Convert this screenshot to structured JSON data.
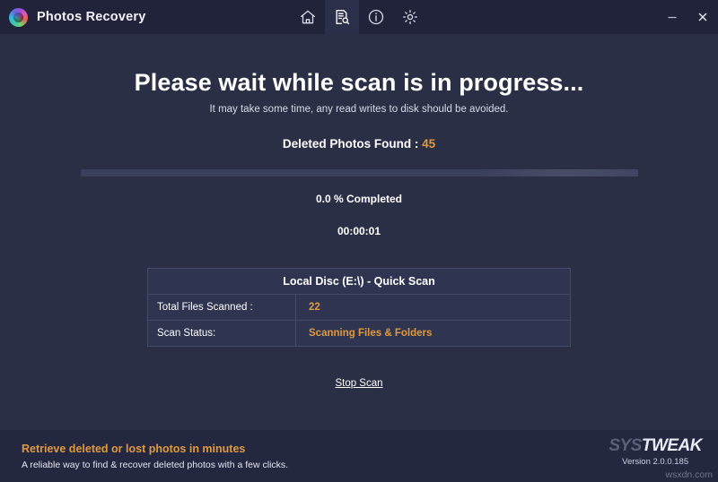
{
  "window": {
    "title": "Photos Recovery",
    "logo_icon": "photos-recovery-logo-icon",
    "minimize_label": "Minimize",
    "close_label": "Close"
  },
  "toolbar": {
    "items": [
      {
        "name": "home",
        "icon": "home-icon",
        "active": false
      },
      {
        "name": "scan",
        "icon": "document-search-icon",
        "active": true
      },
      {
        "name": "info",
        "icon": "info-circle-icon",
        "active": false
      },
      {
        "name": "settings",
        "icon": "gear-icon",
        "active": false
      }
    ]
  },
  "main": {
    "headline": "Please wait while scan is in progress...",
    "subline": "It may take some time, any read writes to disk should be avoided.",
    "found_label": "Deleted Photos Found : ",
    "found_count": "45",
    "progress_percent": 0.0,
    "percent_text": "0.0 % Completed",
    "elapsed_time": "00:00:01",
    "stop_scan_label": "Stop Scan"
  },
  "scan_table": {
    "header": "Local Disc (E:\\) - Quick Scan",
    "rows": [
      {
        "label": "Total Files Scanned :",
        "value": "22"
      },
      {
        "label": "Scan Status:",
        "value": "Scanning Files & Folders"
      }
    ]
  },
  "footer": {
    "tagline": "Retrieve deleted or lost photos in minutes",
    "subtitle": "A reliable way to find & recover deleted photos with a few clicks.",
    "brand_part1": "SYS",
    "brand_part2": "TWEAK",
    "version": "Version 2.0.0.185",
    "watermark": "wsxdn.com"
  },
  "colors": {
    "accent": "#e09a3e",
    "background": "#2b2f46",
    "titlebar": "#20233a",
    "footer": "#242740",
    "text": "#ffffff"
  }
}
